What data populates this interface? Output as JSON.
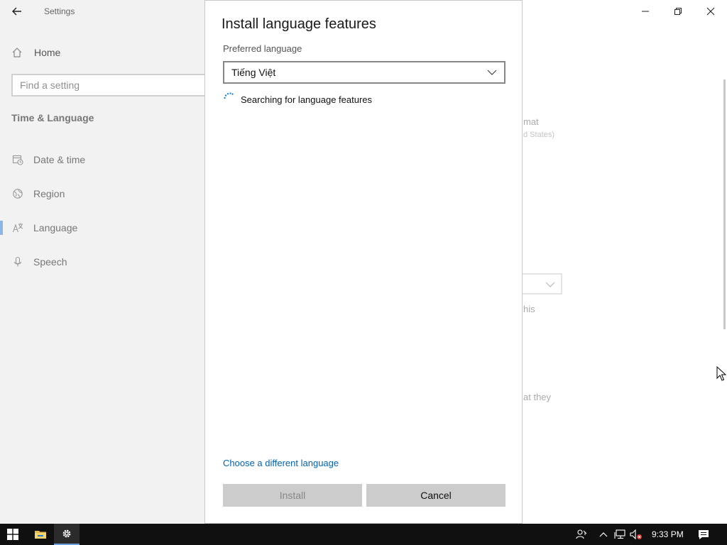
{
  "window": {
    "app_title": "Settings",
    "nav_home": "Home",
    "search_placeholder": "Find a setting",
    "section_heading": "Time & Language",
    "nav_items": [
      {
        "label": "Date & time",
        "icon": "calendar-clock-icon",
        "selected": false
      },
      {
        "label": "Region",
        "icon": "globe-icon",
        "selected": false
      },
      {
        "label": "Language",
        "icon": "language-icon",
        "selected": true
      },
      {
        "label": "Speech",
        "icon": "microphone-icon",
        "selected": false
      }
    ],
    "background_fragments": [
      "mat",
      "d States)",
      "his",
      "at they"
    ]
  },
  "dialog": {
    "title": "Install language features",
    "preferred_label": "Preferred language",
    "selected_language": "Tiếng Việt",
    "status_text": "Searching for language features",
    "change_link": "Choose a different language",
    "install_label": "Install",
    "cancel_label": "Cancel"
  },
  "taskbar": {
    "clock": "9:33 PM"
  },
  "colors": {
    "accent": "#0063b1",
    "sidebar_bg": "#f2f2f2",
    "taskbar_bg": "#101010",
    "button_bg": "#cccccc",
    "selected_indicator": "#8ab5e6"
  }
}
